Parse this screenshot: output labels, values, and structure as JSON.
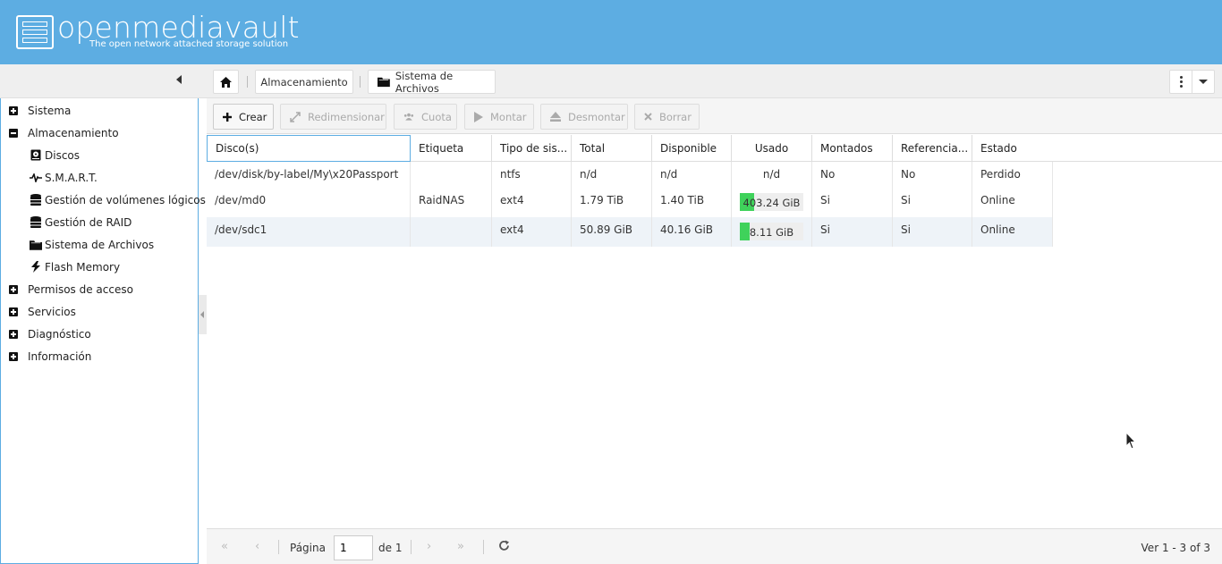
{
  "header": {
    "title": "openmediavault",
    "subtitle": "The open network attached storage solution"
  },
  "breadcrumb": {
    "level1": "Almacenamiento",
    "level2": "Sistema de Archivos"
  },
  "sidebar": {
    "items": [
      {
        "label": "Sistema",
        "type": "top",
        "expanded": false
      },
      {
        "label": "Almacenamiento",
        "type": "top",
        "expanded": true
      },
      {
        "label": "Discos",
        "type": "sub",
        "icon": "disk-icon"
      },
      {
        "label": "S.M.A.R.T.",
        "type": "sub",
        "icon": "heartbeat-icon"
      },
      {
        "label": "Gestión de volúmenes lógicos",
        "type": "sub",
        "icon": "database-icon"
      },
      {
        "label": "Gestión de RAID",
        "type": "sub",
        "icon": "database-icon"
      },
      {
        "label": "Sistema de Archivos",
        "type": "sub",
        "icon": "folder-icon"
      },
      {
        "label": "Flash Memory",
        "type": "sub",
        "icon": "flash-icon"
      },
      {
        "label": "Permisos de acceso",
        "type": "top",
        "expanded": false
      },
      {
        "label": "Servicios",
        "type": "top",
        "expanded": false
      },
      {
        "label": "Diagnóstico",
        "type": "top",
        "expanded": false
      },
      {
        "label": "Información",
        "type": "top",
        "expanded": false
      }
    ]
  },
  "toolbar": {
    "create": "Crear",
    "resize": "Redimensionar",
    "quota": "Cuota",
    "mount": "Montar",
    "unmount": "Desmontar",
    "delete": "Borrar"
  },
  "grid": {
    "columns": [
      "Disco(s)",
      "Etiqueta",
      "Tipo de sis...",
      "Total",
      "Disponible",
      "Usado",
      "Montados",
      "Referencia...",
      "Estado"
    ],
    "rows": [
      {
        "disk": "/dev/disk/by-label/My\\x20Passport",
        "label": "",
        "fstype": "ntfs",
        "total": "n/d",
        "available": "n/d",
        "used": "n/d",
        "used_pct": null,
        "mounted": "No",
        "referenced": "No",
        "status": "Perdido"
      },
      {
        "disk": "/dev/md0",
        "label": "RaidNAS",
        "fstype": "ext4",
        "total": "1.79 TiB",
        "available": "1.40 TiB",
        "used": "403.24 GiB",
        "used_pct": 0.22,
        "mounted": "Si",
        "referenced": "Si",
        "status": "Online"
      },
      {
        "disk": "/dev/sdc1",
        "label": "",
        "fstype": "ext4",
        "total": "50.89 GiB",
        "available": "40.16 GiB",
        "used": "8.11 GiB",
        "used_pct": 0.16,
        "mounted": "Si",
        "referenced": "Si",
        "status": "Online"
      }
    ]
  },
  "pager": {
    "page_label": "Página",
    "page_value": "1",
    "of_label": "de 1",
    "display_info": "Ver 1 - 3 of 3"
  },
  "colors": {
    "header_bg": "#5dade2",
    "usage_fill": "#3fd25b",
    "row_alt": "#eef3f8"
  }
}
